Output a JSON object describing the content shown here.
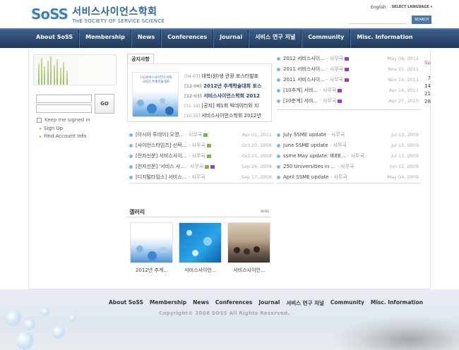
{
  "header": {
    "logo_mark": "SoSS",
    "logo_ko": "서비스사이언스학회",
    "logo_en": "THE SOCIETY OF SERVICE SCIENCE",
    "lang_english": "English",
    "lang_select": "SELECT LANGUAGE ▾",
    "search_button": "SEARCH"
  },
  "nav": {
    "items": [
      "About SoSS",
      "Membership",
      "News",
      "Conferences",
      "Journal",
      "서비스 연구 저널",
      "Community",
      "Misc. Information"
    ]
  },
  "login": {
    "go": "GO",
    "keep": "Keep me signed in",
    "signup": "Sign Up",
    "find": "Find Account Info"
  },
  "notice": {
    "tab": "공지사항",
    "thumb_title": "[사]서비스사이언스학회 2012 추계학술대회",
    "items": [
      {
        "date": "[04-03]",
        "text": "대학(원)생 관광 포스터발표",
        "bold": false
      },
      {
        "date": "[12-06]",
        "text": "2012년 추계학술대회 포스",
        "bold": true
      },
      {
        "date": "[12-03]",
        "text": "서비스사이언스학회 2012",
        "bold": true
      },
      {
        "date": "[11-19]",
        "text": "[공지] 제1회 빅데이터와 지",
        "bold": false
      },
      {
        "date": "[10-15]",
        "text": "서비스사이언스학회 2012년",
        "bold": false
      }
    ]
  },
  "right_list": [
    {
      "title": "2012 서비스사이...",
      "by": "- 사무국",
      "date": "May 08, 2012"
    },
    {
      "title": "2011 서비스사이...",
      "by": "- 사무국",
      "date": "Nov 15, 2011"
    },
    {
      "title": "2011 서비스사이...",
      "by": "- 사무국",
      "date": "Nov 15, 2011"
    },
    {
      "title": "[10추계] 서비...",
      "by": "- 사무국",
      "date": "Apr 14, 2011"
    },
    {
      "title": "[10춘계] 서비...",
      "by": "- 사무국",
      "date": "Apr 27, 2010"
    }
  ],
  "calendar": [
    "Su",
    "",
    "7",
    "14",
    "21",
    "28"
  ],
  "colA": [
    {
      "title": "[아시아 투데이] 오명...",
      "by": "- 사무국",
      "date": "Apr 01, 2011"
    },
    {
      "title": "[사이언스타임즈] 신탁...",
      "by": "- 사무국",
      "date": "Oct 20, 2008"
    },
    {
      "title": "[전자신문] 서비스사이...",
      "by": "- 사무국",
      "date": "Oct 20, 2008"
    },
    {
      "title": "[전자신문] '서비스 사...",
      "by": "- 사무국",
      "date": "Sep 26, 2008"
    },
    {
      "title": "[디지털타임스] 서비스...",
      "by": "- 사무국",
      "date": "Sep 17, 2008"
    }
  ],
  "colB": [
    {
      "title": "July SSME update",
      "by": "- 사무국",
      "date": "Jul 13, 2009"
    },
    {
      "title": "June SSME update",
      "by": "- 사무국",
      "date": "Jul 13, 2009"
    },
    {
      "title": "ssme May update: IEEE...",
      "by": "- 사무국",
      "date": "Jul 13, 2009"
    },
    {
      "title": "250 Universities in ...",
      "by": "- 사무국",
      "date": "Jun 12, 2009"
    },
    {
      "title": "April SSME update",
      "by": "- 사무국",
      "date": "May 04, 2009"
    }
  ],
  "gallery": {
    "title": "갤러리",
    "more": "MORE",
    "captions": [
      "2012년 추계...",
      "서비스사이언...",
      "서비스사이언..."
    ]
  },
  "footer": {
    "nav": [
      "About SoSS",
      "Membership",
      "News",
      "Conferences",
      "Journal",
      "서비스 연구 저널",
      "Community",
      "Misc. Information"
    ],
    "copyright": "Copyright© 2008 SOSS All Rights Reserved."
  }
}
